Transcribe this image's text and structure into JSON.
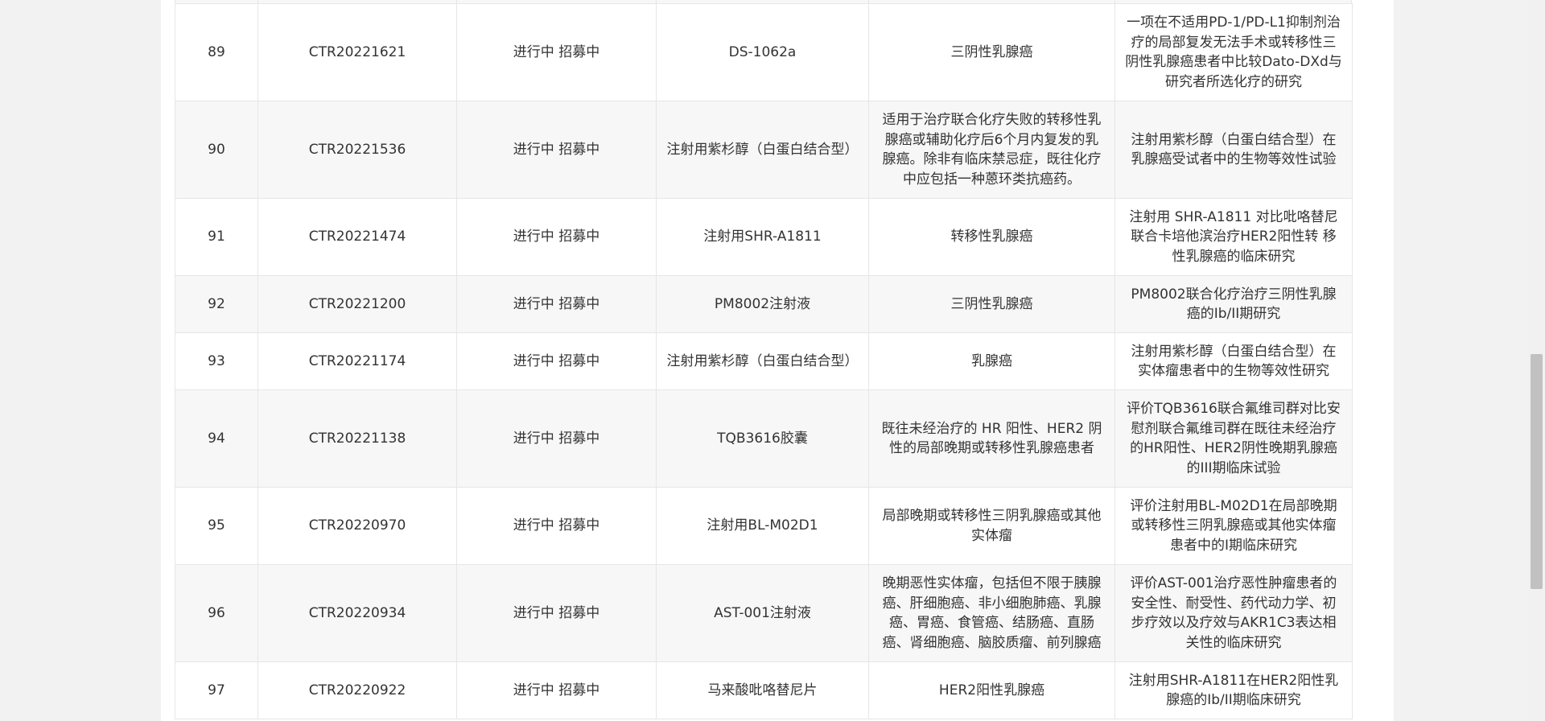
{
  "trials": {
    "rows": [
      {
        "index": "89",
        "reg_no": "CTR20221621",
        "status": "进行中 招募中",
        "drug": "DS-1062a",
        "indication": "三阴性乳腺癌",
        "title": "一项在不适用PD-1/PD-L1抑制剂治疗的局部复发无法手术或转移性三阴性乳腺癌患者中比较Dato-DXd与研究者所选化疗的研究"
      },
      {
        "index": "90",
        "reg_no": "CTR20221536",
        "status": "进行中 招募中",
        "drug": "注射用紫杉醇（白蛋白结合型）",
        "indication": "适用于治疗联合化疗失败的转移性乳腺癌或辅助化疗后6个月内复发的乳腺癌。除非有临床禁忌症，既往化疗中应包括一种蒽环类抗癌药。",
        "title": "注射用紫杉醇（白蛋白结合型）在乳腺癌受试者中的生物等效性试验"
      },
      {
        "index": "91",
        "reg_no": "CTR20221474",
        "status": "进行中 招募中",
        "drug": "注射用SHR-A1811",
        "indication": "转移性乳腺癌",
        "title": "注射用 SHR-A1811 对比吡咯替尼联合卡培他滨治疗HER2阳性转 移性乳腺癌的临床研究"
      },
      {
        "index": "92",
        "reg_no": "CTR20221200",
        "status": "进行中 招募中",
        "drug": "PM8002注射液",
        "indication": "三阴性乳腺癌",
        "title": "PM8002联合化疗治疗三阴性乳腺癌的Ib/II期研究"
      },
      {
        "index": "93",
        "reg_no": "CTR20221174",
        "status": "进行中 招募中",
        "drug": "注射用紫杉醇（白蛋白结合型）",
        "indication": "乳腺癌",
        "title": "注射用紫杉醇（白蛋白结合型）在实体瘤患者中的生物等效性研究"
      },
      {
        "index": "94",
        "reg_no": "CTR20221138",
        "status": "进行中 招募中",
        "drug": "TQB3616胶囊",
        "indication": "既往未经治疗的 HR 阳性、HER2 阴性的局部晚期或转移性乳腺癌患者",
        "title": "评价TQB3616联合氟维司群对比安慰剂联合氟维司群在既往未经治疗的HR阳性、HER2阴性晚期乳腺癌的III期临床试验"
      },
      {
        "index": "95",
        "reg_no": "CTR20220970",
        "status": "进行中 招募中",
        "drug": "注射用BL-M02D1",
        "indication": "局部晚期或转移性三阴乳腺癌或其他实体瘤",
        "title": "评价注射用BL-M02D1在局部晚期或转移性三阴乳腺癌或其他实体瘤患者中的I期临床研究"
      },
      {
        "index": "96",
        "reg_no": "CTR20220934",
        "status": "进行中 招募中",
        "drug": "AST-001注射液",
        "indication": "晚期恶性实体瘤，包括但不限于胰腺癌、肝细胞癌、非小细胞肺癌、乳腺癌、胃癌、食管癌、结肠癌、直肠癌、肾细胞癌、脑胶质瘤、前列腺癌",
        "title": "评价AST-001治疗恶性肿瘤患者的安全性、耐受性、药代动力学、初步疗效以及疗效与AKR1C3表达相关性的临床研究"
      },
      {
        "index": "97",
        "reg_no": "CTR20220922",
        "status": "进行中 招募中",
        "drug": "马来酸吡咯替尼片",
        "indication": "HER2阳性乳腺癌",
        "title": "注射用SHR-A1811在HER2阳性乳腺癌的Ib/II期临床研究"
      }
    ]
  }
}
